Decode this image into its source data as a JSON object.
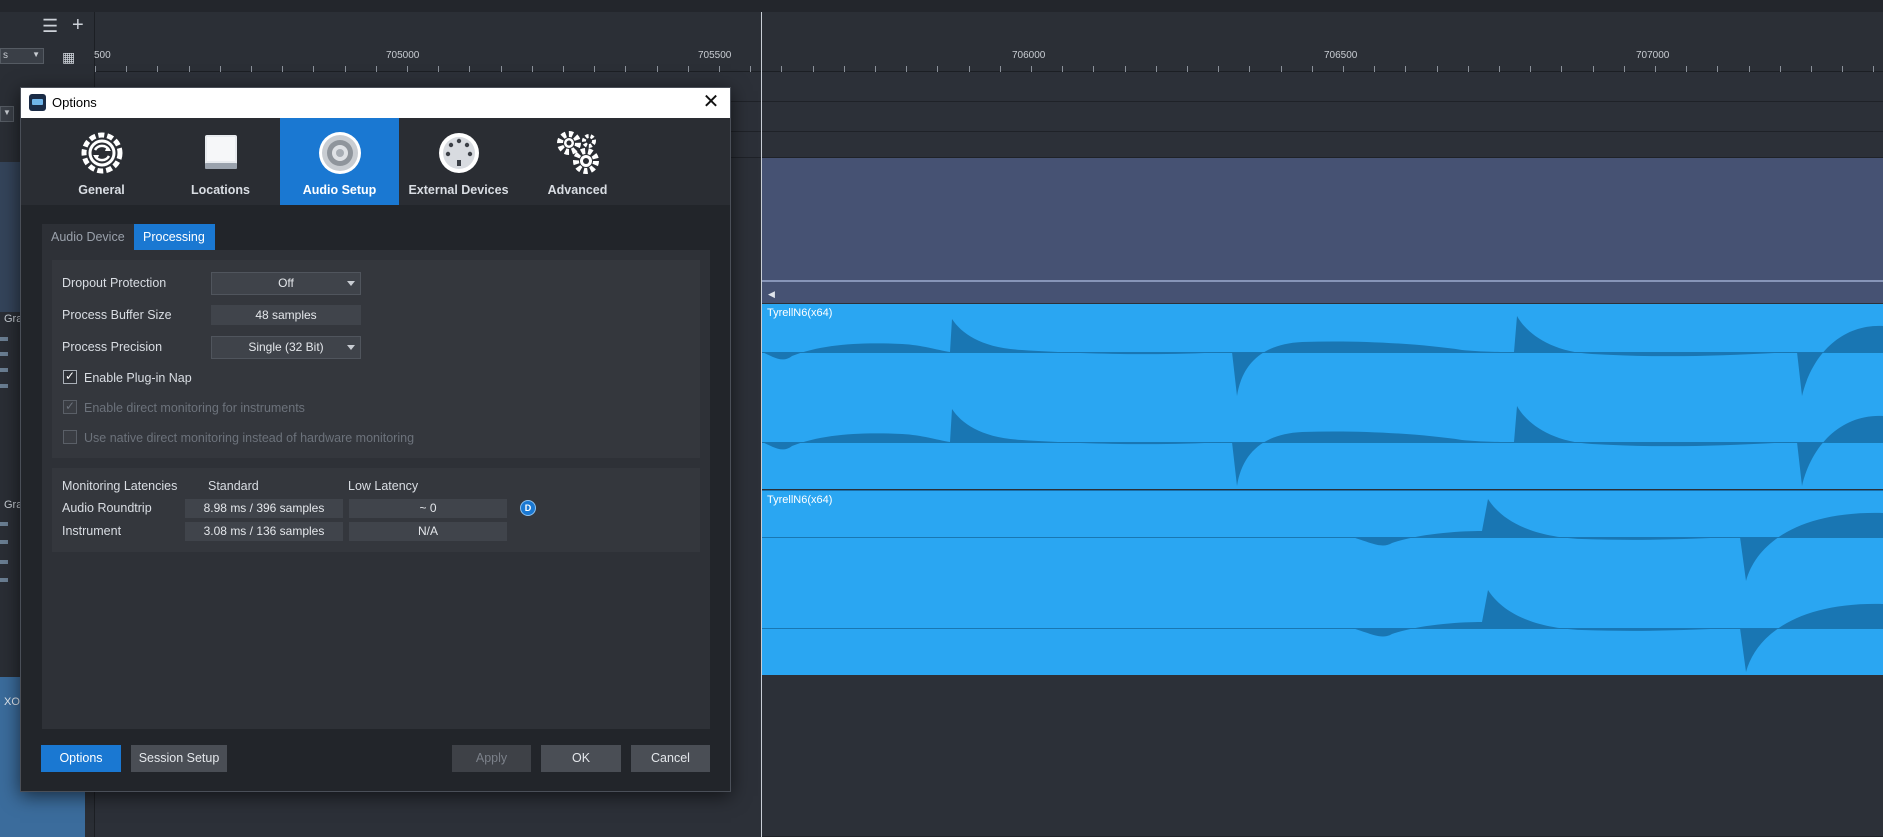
{
  "daw": {
    "ruler_labels": [
      "500",
      "705000",
      "705500",
      "706000",
      "706500",
      "707000"
    ],
    "track_labels": [
      "Gra",
      "Gra",
      "XO"
    ],
    "clip_names": [
      "TyrellN6(x64)",
      "TyrellN6(x64)"
    ],
    "left_dropdown": "s",
    "icons": {
      "list": "list-icon",
      "add": "plus-icon",
      "speaker": "speaker-icon"
    },
    "colors": {
      "clip": "#2aa6f2",
      "automation": "#465273",
      "accent": "#1a78d2"
    }
  },
  "dialog": {
    "title": "Options",
    "categories": [
      {
        "label": "General",
        "icon": "refresh-gear-icon"
      },
      {
        "label": "Locations",
        "icon": "hard-drive-icon"
      },
      {
        "label": "Audio Setup",
        "icon": "speaker-cone-icon",
        "active": true
      },
      {
        "label": "External Devices",
        "icon": "midi-connector-icon"
      },
      {
        "label": "Advanced",
        "icon": "gears-icon"
      }
    ],
    "tabs": [
      {
        "label": "Audio Device"
      },
      {
        "label": "Processing",
        "active": true
      }
    ],
    "processing": {
      "dropout_label": "Dropout Protection",
      "dropout_value": "Off",
      "buffer_label": "Process Buffer Size",
      "buffer_value": "48 samples",
      "precision_label": "Process Precision",
      "precision_value": "Single (32 Bit)",
      "plugin_nap_label": "Enable Plug-in Nap",
      "plugin_nap_checked": true,
      "direct_monitoring_label": "Enable direct monitoring for instruments",
      "native_monitoring_label": "Use native direct monitoring instead of hardware monitoring"
    },
    "latencies": {
      "header": "Monitoring Latencies",
      "col_standard": "Standard",
      "col_low": "Low Latency",
      "rows": [
        {
          "label": "Audio Roundtrip",
          "standard": "8.98 ms / 396 samples",
          "low": "~ 0"
        },
        {
          "label": "Instrument",
          "standard": "3.08 ms / 136 samples",
          "low": "N/A"
        }
      ],
      "badge": "D"
    },
    "footer": {
      "options": "Options",
      "session_setup": "Session Setup",
      "apply": "Apply",
      "ok": "OK",
      "cancel": "Cancel"
    }
  }
}
